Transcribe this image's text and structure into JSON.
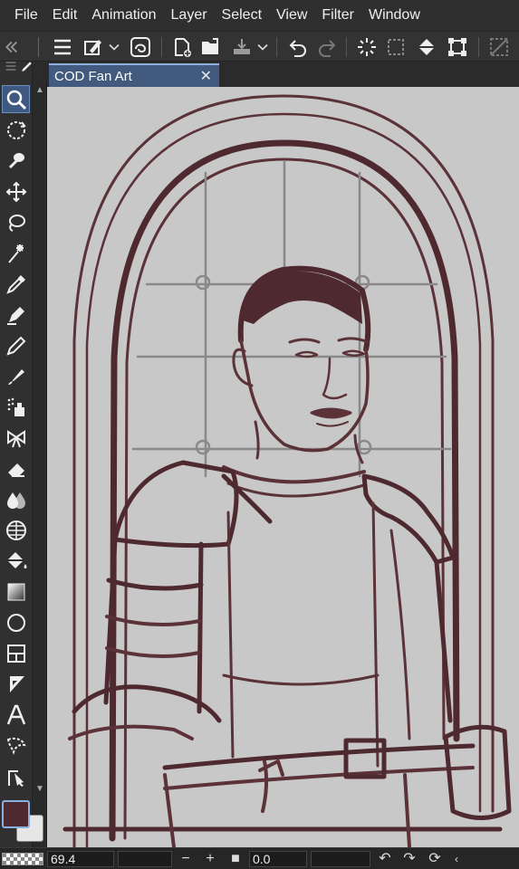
{
  "menu": [
    "File",
    "Edit",
    "Animation",
    "Layer",
    "Select",
    "View",
    "Filter",
    "Window"
  ],
  "document": {
    "tab_title": "COD Fan Art",
    "close_glyph": "✕"
  },
  "commands": [
    "menu-icon",
    "layer-property-icon",
    "stabilization-icon",
    "new-icon",
    "open-icon",
    "save-icon",
    "undo-icon",
    "redo-icon",
    "selection-launcher-icon",
    "clear-selection-icon",
    "fill-icon",
    "transform-icon",
    "crop-icon"
  ],
  "tools": [
    "zoom-icon",
    "move-layer-rotate-icon",
    "auto-select-icon",
    "move-icon",
    "lasso-icon",
    "magic-wand-icon",
    "eyedropper-icon",
    "pen-icon",
    "pencil-icon",
    "brush-icon",
    "airbrush-icon",
    "decoration-icon",
    "eraser-icon",
    "blend-icon",
    "figure-icon",
    "fill-icon",
    "gradient-icon",
    "shape-icon",
    "frame-icon",
    "ruler-icon",
    "text-icon",
    "balloon-icon",
    "correct-line-icon"
  ],
  "colors": {
    "main": "#4e2a30",
    "sub": "#e6e6e6",
    "accent": "#425a7d",
    "canvas": "#c8c8c8",
    "line": "#4e2a30"
  },
  "status": {
    "zoom": "69.4",
    "minus": "−",
    "plus": "+",
    "angle": "0.0"
  }
}
